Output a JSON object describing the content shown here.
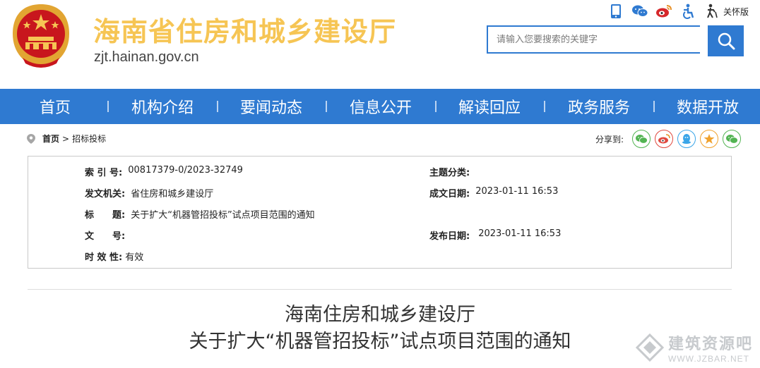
{
  "header": {
    "site_title": "海南省住房和城乡建设厅",
    "domain": "zjt.hainan.gov.cn",
    "top_icons": [
      "mobile-icon",
      "wechat-icon",
      "weibo-icon",
      "accessibility-icon"
    ],
    "care_label": "关怀版"
  },
  "search": {
    "placeholder": "请输入您要搜索的关键字"
  },
  "nav": {
    "items": [
      "首页",
      "机构介绍",
      "要闻动态",
      "信息公开",
      "解读回应",
      "政务服务",
      "数据开放"
    ]
  },
  "breadcrumb": {
    "home": "首页",
    "separator": ">",
    "current": "招标投标"
  },
  "share": {
    "label": "分享到:",
    "targets": [
      "wechat-icon",
      "weibo-icon",
      "qq-icon",
      "qzone-icon",
      "wechat-friends-icon"
    ]
  },
  "meta": {
    "index_label": "索 引 号:",
    "index_value": "00817379-0/2023-32749",
    "topic_label": "主题分类:",
    "topic_value": "",
    "issuer_label": "发文机关:",
    "issuer_value": "省住房和城乡建设厅",
    "created_label": "成文日期:",
    "created_value": "2023-01-11 16:53",
    "title_label": "标　　题:",
    "title_value": "关于扩大“机器管招投标”试点项目范围的通知",
    "docno_label": "文　　号:",
    "docno_value": "",
    "published_label": "发布日期:",
    "published_value": "2023-01-11 16:53",
    "validity_label": "时 效 性:",
    "validity_value": "有效"
  },
  "document": {
    "title_line1": "海南住房和城乡建设厅",
    "title_line2": "关于扩大“机器管招投标”试点项目范围的通知"
  },
  "watermark": {
    "text": "建筑资源吧",
    "url": "WWW.JZBAR.NET"
  },
  "colors": {
    "nav_blue": "#2f7ad1",
    "title_gold": "#f6c554",
    "emblem_red": "#c8161d"
  }
}
